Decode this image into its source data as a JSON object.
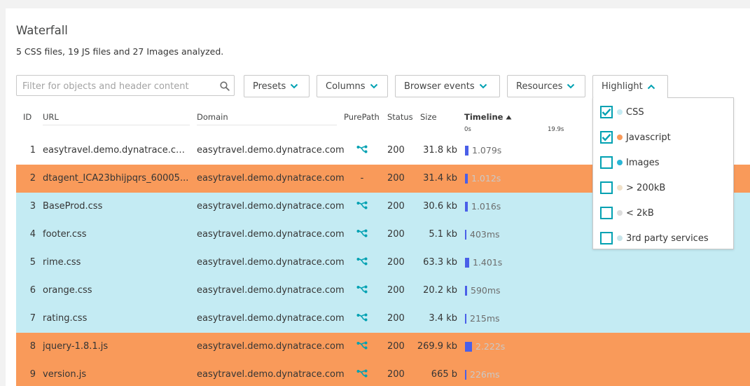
{
  "panel": {
    "title": "Waterfall",
    "summary": "5 CSS files, 19 JS files and 27 Images analyzed."
  },
  "filter": {
    "placeholder": "Filter for objects and header content",
    "icon": "search-icon"
  },
  "toolbar": {
    "presets": "Presets",
    "columns": "Columns",
    "browser_events": "Browser events",
    "resources": "Resources",
    "highlight": "Highlight"
  },
  "table": {
    "headers": {
      "id": "ID",
      "url": "URL",
      "domain": "Domain",
      "purepath": "PurePath",
      "status": "Status",
      "size": "Size",
      "timeline": "Timeline"
    },
    "timeline_scale": [
      "0s",
      "19.9s"
    ],
    "rows": [
      {
        "id": "1",
        "url": "easytravel.demo.dynatrace.com",
        "domain": "easytravel.demo.dynatrace.com",
        "purepath": "icon",
        "status": "200",
        "size": "31.8 kb",
        "duration": "1.079s",
        "duration_s": 1.079,
        "highlight": "none"
      },
      {
        "id": "2",
        "url": "dtagent_ICA23bhijpqrs_60005...",
        "domain": "easytravel.demo.dynatrace.com",
        "purepath": "-",
        "status": "200",
        "size": "31.4 kb",
        "duration": "1.012s",
        "duration_s": 1.012,
        "highlight": "javascript"
      },
      {
        "id": "3",
        "url": "BaseProd.css",
        "domain": "easytravel.demo.dynatrace.com",
        "purepath": "icon",
        "status": "200",
        "size": "30.6 kb",
        "duration": "1.016s",
        "duration_s": 1.016,
        "highlight": "css"
      },
      {
        "id": "4",
        "url": "footer.css",
        "domain": "easytravel.demo.dynatrace.com",
        "purepath": "icon",
        "status": "200",
        "size": "5.1 kb",
        "duration": "403ms",
        "duration_s": 0.403,
        "highlight": "css"
      },
      {
        "id": "5",
        "url": "rime.css",
        "domain": "easytravel.demo.dynatrace.com",
        "purepath": "icon",
        "status": "200",
        "size": "63.3 kb",
        "duration": "1.401s",
        "duration_s": 1.401,
        "highlight": "css"
      },
      {
        "id": "6",
        "url": "orange.css",
        "domain": "easytravel.demo.dynatrace.com",
        "purepath": "icon",
        "status": "200",
        "size": "20.2 kb",
        "duration": "590ms",
        "duration_s": 0.59,
        "highlight": "css"
      },
      {
        "id": "7",
        "url": "rating.css",
        "domain": "easytravel.demo.dynatrace.com",
        "purepath": "icon",
        "status": "200",
        "size": "3.4 kb",
        "duration": "215ms",
        "duration_s": 0.215,
        "highlight": "css"
      },
      {
        "id": "8",
        "url": "jquery-1.8.1.js",
        "domain": "easytravel.demo.dynatrace.com",
        "purepath": "icon",
        "status": "200",
        "size": "269.9 kb",
        "duration": "2.222s",
        "duration_s": 2.222,
        "highlight": "javascript"
      },
      {
        "id": "9",
        "url": "version.js",
        "domain": "easytravel.demo.dynatrace.com",
        "purepath": "icon",
        "status": "200",
        "size": "665 b",
        "duration": "226ms",
        "duration_s": 0.226,
        "highlight": "javascript"
      }
    ]
  },
  "highlight_menu": {
    "options": [
      {
        "label": "CSS",
        "checked": true,
        "dot_color": "#c4ebf3"
      },
      {
        "label": "Javascript",
        "checked": true,
        "dot_color": "#f99a5a"
      },
      {
        "label": "Images",
        "checked": false,
        "dot_color": "#2ab6d6"
      },
      {
        "label": "> 200kB",
        "checked": false,
        "dot_color": "#f0e0c8"
      },
      {
        "label": "< 2kB",
        "checked": false,
        "dot_color": "#dcdcdc"
      },
      {
        "label": "3rd party services",
        "checked": false,
        "dot_color": "#c6e4ea"
      }
    ]
  },
  "colors": {
    "accent": "#00a1b2",
    "javascript_row": "#f99a5a",
    "css_row": "#c4ebf3",
    "timeline_bar": "#4a5fe8"
  }
}
